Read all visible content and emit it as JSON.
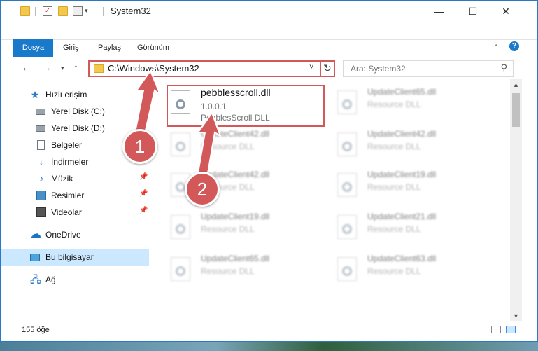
{
  "window": {
    "title": "System32",
    "controls": {
      "minimize": "—",
      "maximize": "☐",
      "close": "✕"
    }
  },
  "ribbon": {
    "tabs": [
      "Dosya",
      "Giriş",
      "Paylaş",
      "Görünüm"
    ],
    "help": "?"
  },
  "address": {
    "path": "C:\\Windows\\System32",
    "search_placeholder": "Ara: System32"
  },
  "sidebar": {
    "items": [
      {
        "label": "Hızlı erişim",
        "icon": "star-icon"
      },
      {
        "label": "Yerel Disk (C:)",
        "icon": "disk-icon"
      },
      {
        "label": "Yerel Disk (D:)",
        "icon": "disk-icon"
      },
      {
        "label": "Belgeler",
        "icon": "document-icon",
        "pinned": true
      },
      {
        "label": "İndirmeler",
        "icon": "download-icon",
        "pinned": true
      },
      {
        "label": "Müzik",
        "icon": "music-icon",
        "pinned": true
      },
      {
        "label": "Resimler",
        "icon": "pictures-icon",
        "pinned": true
      },
      {
        "label": "Videolar",
        "icon": "video-icon",
        "pinned": true
      },
      {
        "label": "OneDrive",
        "icon": "cloud-icon"
      },
      {
        "label": "Bu bilgisayar",
        "icon": "computer-icon",
        "selected": true
      },
      {
        "label": "Ağ",
        "icon": "network-icon"
      }
    ]
  },
  "files": [
    {
      "name": "pebblesscroll.dll",
      "version": "1.0.0.1",
      "description": "PebblesScroll DLL",
      "highlighted": true
    },
    {
      "name": "UpdateClient65.dll",
      "description": "Resource DLL"
    },
    {
      "name": "UpdateClient42.dll",
      "description": "Resource DLL"
    },
    {
      "name": "UpdateClient42.dll",
      "description": "Resource DLL"
    },
    {
      "name": "UpdateClient42.dll",
      "description": "Resource DLL"
    },
    {
      "name": "UpdateClient19.dll",
      "description": "Resource DLL"
    },
    {
      "name": "UpdateClient19.dll",
      "description": "Resource DLL"
    },
    {
      "name": "UpdateClient21.dll",
      "description": "Resource DLL"
    },
    {
      "name": "UpdateClient65.dll",
      "description": "Resource DLL"
    },
    {
      "name": "UpdateClient63.dll",
      "description": "Resource DLL"
    }
  ],
  "status": {
    "item_count": "155 öğe"
  },
  "annotations": {
    "step1": "1",
    "step2": "2",
    "color": "#d3585a"
  }
}
